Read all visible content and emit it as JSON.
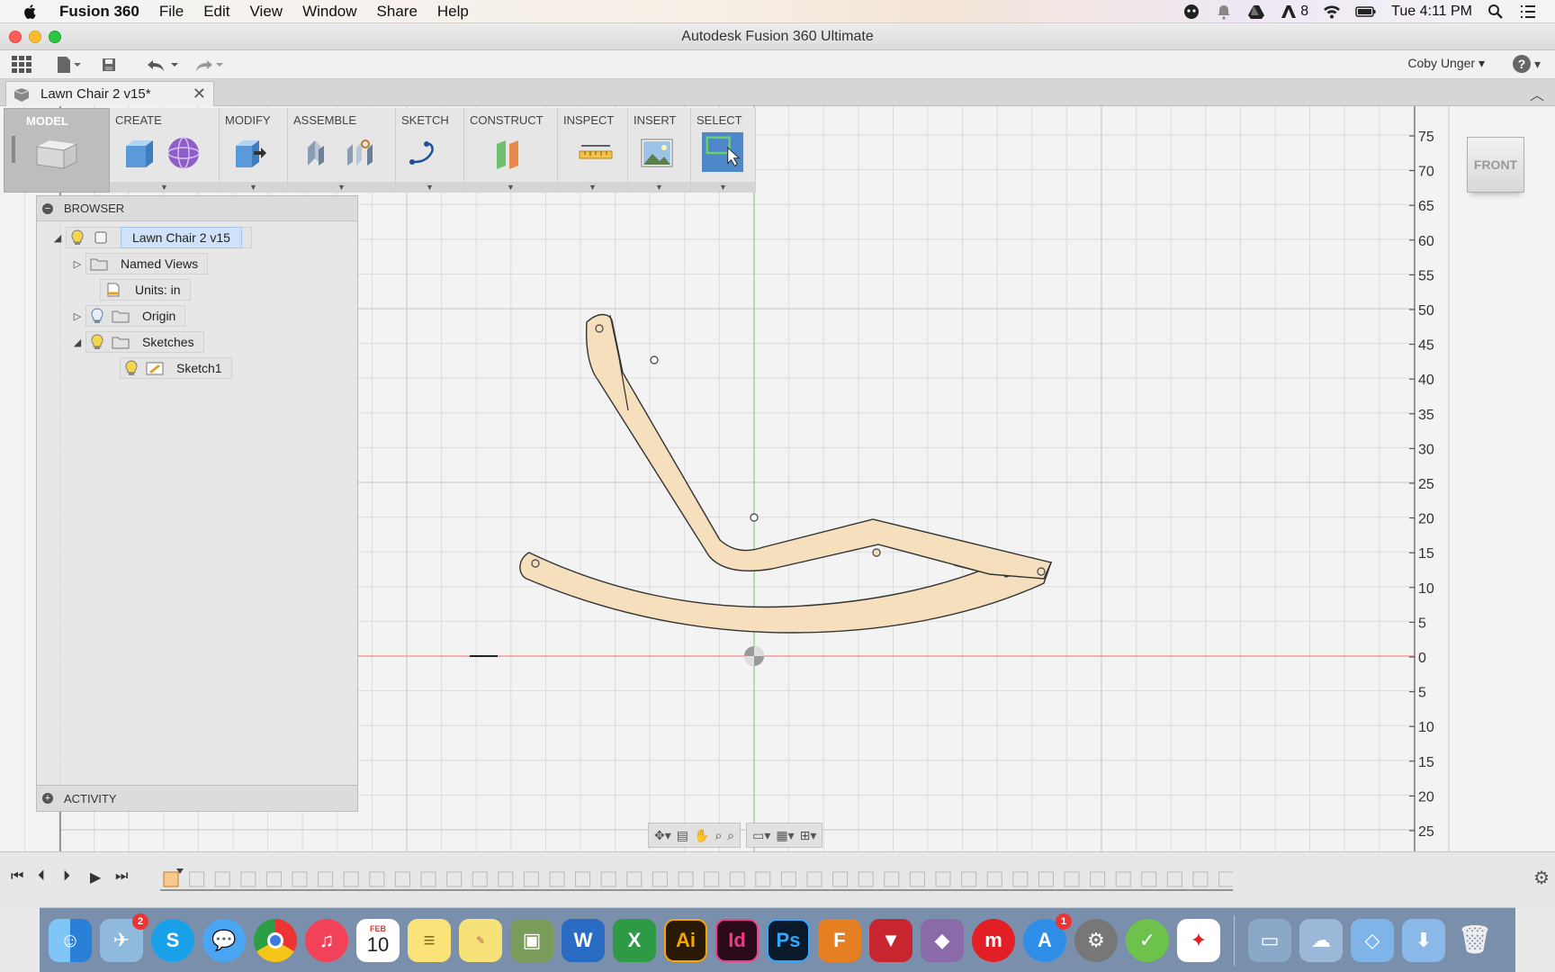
{
  "menubar": {
    "app_name": "Fusion 360",
    "items": [
      "File",
      "Edit",
      "View",
      "Window",
      "Share",
      "Help"
    ],
    "adobe_count": "8",
    "clock": "Tue 4:11 PM"
  },
  "window": {
    "title": "Autodesk Fusion 360 Ultimate"
  },
  "quick_access": {
    "user_name": "Coby Unger"
  },
  "document_tab": {
    "label": "Lawn Chair 2 v15*"
  },
  "ribbon": {
    "workspace": "MODEL",
    "groups": [
      "CREATE",
      "MODIFY",
      "ASSEMBLE",
      "SKETCH",
      "CONSTRUCT",
      "INSPECT",
      "INSERT",
      "SELECT"
    ]
  },
  "browser": {
    "title": "BROWSER",
    "root": "Lawn Chair 2 v15",
    "named_views": "Named Views",
    "units": "Units: in",
    "origin": "Origin",
    "sketches": "Sketches",
    "sketch1": "Sketch1"
  },
  "activity": {
    "title": "ACTIVITY"
  },
  "viewcube": {
    "face": "FRONT"
  },
  "ruler": {
    "labels": [
      "75",
      "70",
      "65",
      "60",
      "55",
      "50",
      "45",
      "40",
      "35",
      "30",
      "25",
      "20",
      "15",
      "10",
      "5",
      "0",
      "5",
      "10",
      "15",
      "20",
      "25"
    ]
  },
  "dock": {
    "badges": {
      "mail": "2",
      "appstore": "1"
    },
    "calendar": {
      "month": "FEB",
      "day": "10"
    },
    "apps": {
      "illustrator": "Ai",
      "indesign": "Id",
      "photoshop": "Ps"
    }
  }
}
